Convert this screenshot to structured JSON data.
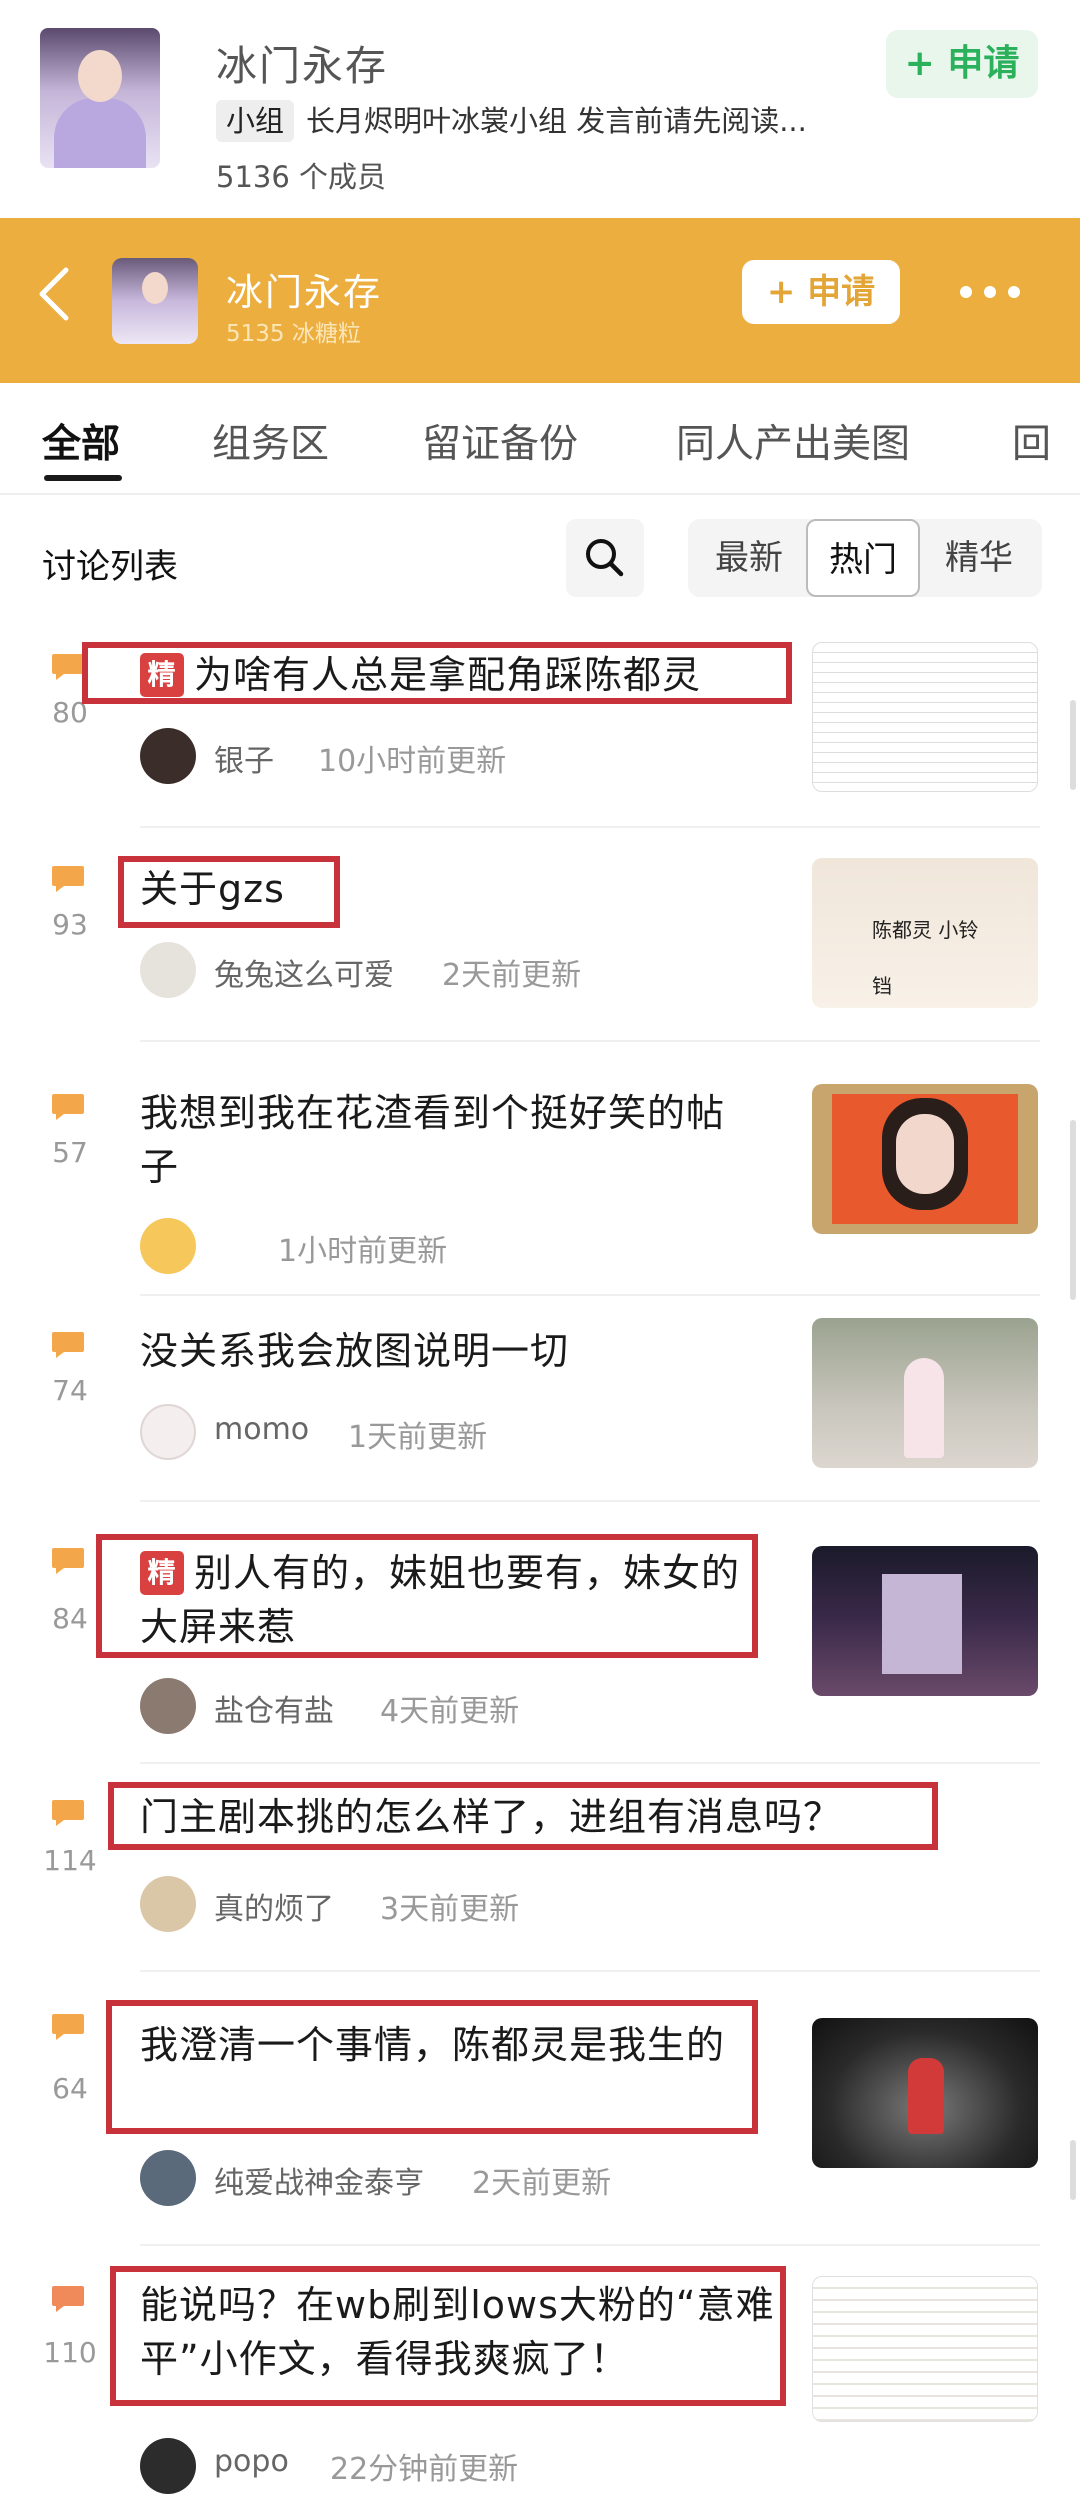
{
  "group": {
    "name": "冰门永存",
    "tag": "小组",
    "description": "长月烬明叶冰裳小组 发言前请先阅读...",
    "members": "5136 个成员",
    "apply_label": "+ 申请"
  },
  "header": {
    "title": "冰门永存",
    "subtitle": "5135 冰糖粒",
    "apply_label": "+ 申请"
  },
  "tabs": [
    "全部",
    "组务区",
    "留证备份",
    "同人产出美图",
    "回"
  ],
  "list": {
    "title": "讨论列表",
    "sort_options": [
      "最新",
      "热门",
      "精华"
    ],
    "selected_sort": "热门"
  },
  "posts": [
    {
      "count": "80",
      "badge": "精",
      "title": "为啥有人总是拿配角踩陈都灵",
      "author": "银子",
      "time": "10小时前更新",
      "thumb_text": ""
    },
    {
      "count": "93",
      "badge": "",
      "title": "关于gzs",
      "author": "兔兔这么可爱",
      "time": "2天前更新",
      "thumb_text": "陈都灵 小铃铛"
    },
    {
      "count": "57",
      "badge": "",
      "title": "我想到我在花渣看到个挺好笑的帖子",
      "author": "",
      "time": "1小时前更新",
      "thumb_text": ""
    },
    {
      "count": "74",
      "badge": "",
      "title": "没关系我会放图说明一切",
      "author": "momo",
      "time": "1天前更新",
      "thumb_text": ""
    },
    {
      "count": "84",
      "badge": "精",
      "title": "别人有的，妹姐也要有，妹女的大屏来惹",
      "author": "盐仓有盐",
      "time": "4天前更新",
      "thumb_text": ""
    },
    {
      "count": "114",
      "badge": "",
      "title": "门主剧本挑的怎么样了，进组有消息吗？",
      "author": "真的烦了",
      "time": "3天前更新",
      "thumb_text": ""
    },
    {
      "count": "64",
      "badge": "",
      "title": "我澄清一个事情，陈都灵是我生的",
      "author": "纯爱战神金泰亨",
      "time": "2天前更新",
      "thumb_text": ""
    },
    {
      "count": "110",
      "badge": "",
      "title": "能说吗？在wb刷到lows大粉的“意难平”小作文，看得我爽疯了！",
      "author": "popo",
      "time": "22分钟前更新",
      "thumb_text": ""
    }
  ],
  "colors": {
    "header_orange": "#ecae3f",
    "apply_green": "#2bb15b",
    "highlight_red": "#c8323a",
    "badge_red": "#d94040",
    "comment_icon": "#f4a64a"
  }
}
